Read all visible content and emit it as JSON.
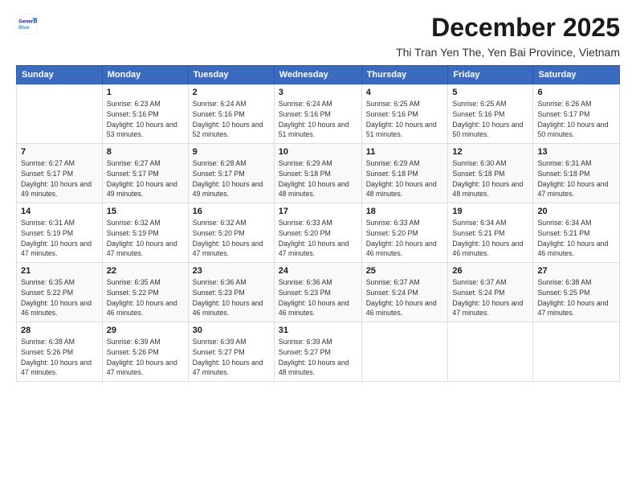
{
  "logo": {
    "line1": "General",
    "line2": "Blue"
  },
  "title": "December 2025",
  "subtitle": "Thi Tran Yen The, Yen Bai Province, Vietnam",
  "header": {
    "days": [
      "Sunday",
      "Monday",
      "Tuesday",
      "Wednesday",
      "Thursday",
      "Friday",
      "Saturday"
    ]
  },
  "weeks": [
    {
      "cells": [
        {
          "day": "",
          "info": ""
        },
        {
          "day": "1",
          "info": "Sunrise: 6:23 AM\nSunset: 5:16 PM\nDaylight: 10 hours\nand 53 minutes."
        },
        {
          "day": "2",
          "info": "Sunrise: 6:24 AM\nSunset: 5:16 PM\nDaylight: 10 hours\nand 52 minutes."
        },
        {
          "day": "3",
          "info": "Sunrise: 6:24 AM\nSunset: 5:16 PM\nDaylight: 10 hours\nand 51 minutes."
        },
        {
          "day": "4",
          "info": "Sunrise: 6:25 AM\nSunset: 5:16 PM\nDaylight: 10 hours\nand 51 minutes."
        },
        {
          "day": "5",
          "info": "Sunrise: 6:25 AM\nSunset: 5:16 PM\nDaylight: 10 hours\nand 50 minutes."
        },
        {
          "day": "6",
          "info": "Sunrise: 6:26 AM\nSunset: 5:17 PM\nDaylight: 10 hours\nand 50 minutes."
        }
      ]
    },
    {
      "cells": [
        {
          "day": "7",
          "info": "Sunrise: 6:27 AM\nSunset: 5:17 PM\nDaylight: 10 hours\nand 49 minutes."
        },
        {
          "day": "8",
          "info": "Sunrise: 6:27 AM\nSunset: 5:17 PM\nDaylight: 10 hours\nand 49 minutes."
        },
        {
          "day": "9",
          "info": "Sunrise: 6:28 AM\nSunset: 5:17 PM\nDaylight: 10 hours\nand 49 minutes."
        },
        {
          "day": "10",
          "info": "Sunrise: 6:29 AM\nSunset: 5:18 PM\nDaylight: 10 hours\nand 48 minutes."
        },
        {
          "day": "11",
          "info": "Sunrise: 6:29 AM\nSunset: 5:18 PM\nDaylight: 10 hours\nand 48 minutes."
        },
        {
          "day": "12",
          "info": "Sunrise: 6:30 AM\nSunset: 5:18 PM\nDaylight: 10 hours\nand 48 minutes."
        },
        {
          "day": "13",
          "info": "Sunrise: 6:31 AM\nSunset: 5:18 PM\nDaylight: 10 hours\nand 47 minutes."
        }
      ]
    },
    {
      "cells": [
        {
          "day": "14",
          "info": "Sunrise: 6:31 AM\nSunset: 5:19 PM\nDaylight: 10 hours\nand 47 minutes."
        },
        {
          "day": "15",
          "info": "Sunrise: 6:32 AM\nSunset: 5:19 PM\nDaylight: 10 hours\nand 47 minutes."
        },
        {
          "day": "16",
          "info": "Sunrise: 6:32 AM\nSunset: 5:20 PM\nDaylight: 10 hours\nand 47 minutes."
        },
        {
          "day": "17",
          "info": "Sunrise: 6:33 AM\nSunset: 5:20 PM\nDaylight: 10 hours\nand 47 minutes."
        },
        {
          "day": "18",
          "info": "Sunrise: 6:33 AM\nSunset: 5:20 PM\nDaylight: 10 hours\nand 46 minutes."
        },
        {
          "day": "19",
          "info": "Sunrise: 6:34 AM\nSunset: 5:21 PM\nDaylight: 10 hours\nand 46 minutes."
        },
        {
          "day": "20",
          "info": "Sunrise: 6:34 AM\nSunset: 5:21 PM\nDaylight: 10 hours\nand 46 minutes."
        }
      ]
    },
    {
      "cells": [
        {
          "day": "21",
          "info": "Sunrise: 6:35 AM\nSunset: 5:22 PM\nDaylight: 10 hours\nand 46 minutes."
        },
        {
          "day": "22",
          "info": "Sunrise: 6:35 AM\nSunset: 5:22 PM\nDaylight: 10 hours\nand 46 minutes."
        },
        {
          "day": "23",
          "info": "Sunrise: 6:36 AM\nSunset: 5:23 PM\nDaylight: 10 hours\nand 46 minutes."
        },
        {
          "day": "24",
          "info": "Sunrise: 6:36 AM\nSunset: 5:23 PM\nDaylight: 10 hours\nand 46 minutes."
        },
        {
          "day": "25",
          "info": "Sunrise: 6:37 AM\nSunset: 5:24 PM\nDaylight: 10 hours\nand 46 minutes."
        },
        {
          "day": "26",
          "info": "Sunrise: 6:37 AM\nSunset: 5:24 PM\nDaylight: 10 hours\nand 47 minutes."
        },
        {
          "day": "27",
          "info": "Sunrise: 6:38 AM\nSunset: 5:25 PM\nDaylight: 10 hours\nand 47 minutes."
        }
      ]
    },
    {
      "cells": [
        {
          "day": "28",
          "info": "Sunrise: 6:38 AM\nSunset: 5:26 PM\nDaylight: 10 hours\nand 47 minutes."
        },
        {
          "day": "29",
          "info": "Sunrise: 6:39 AM\nSunset: 5:26 PM\nDaylight: 10 hours\nand 47 minutes."
        },
        {
          "day": "30",
          "info": "Sunrise: 6:39 AM\nSunset: 5:27 PM\nDaylight: 10 hours\nand 47 minutes."
        },
        {
          "day": "31",
          "info": "Sunrise: 6:39 AM\nSunset: 5:27 PM\nDaylight: 10 hours\nand 48 minutes."
        },
        {
          "day": "",
          "info": ""
        },
        {
          "day": "",
          "info": ""
        },
        {
          "day": "",
          "info": ""
        }
      ]
    }
  ]
}
